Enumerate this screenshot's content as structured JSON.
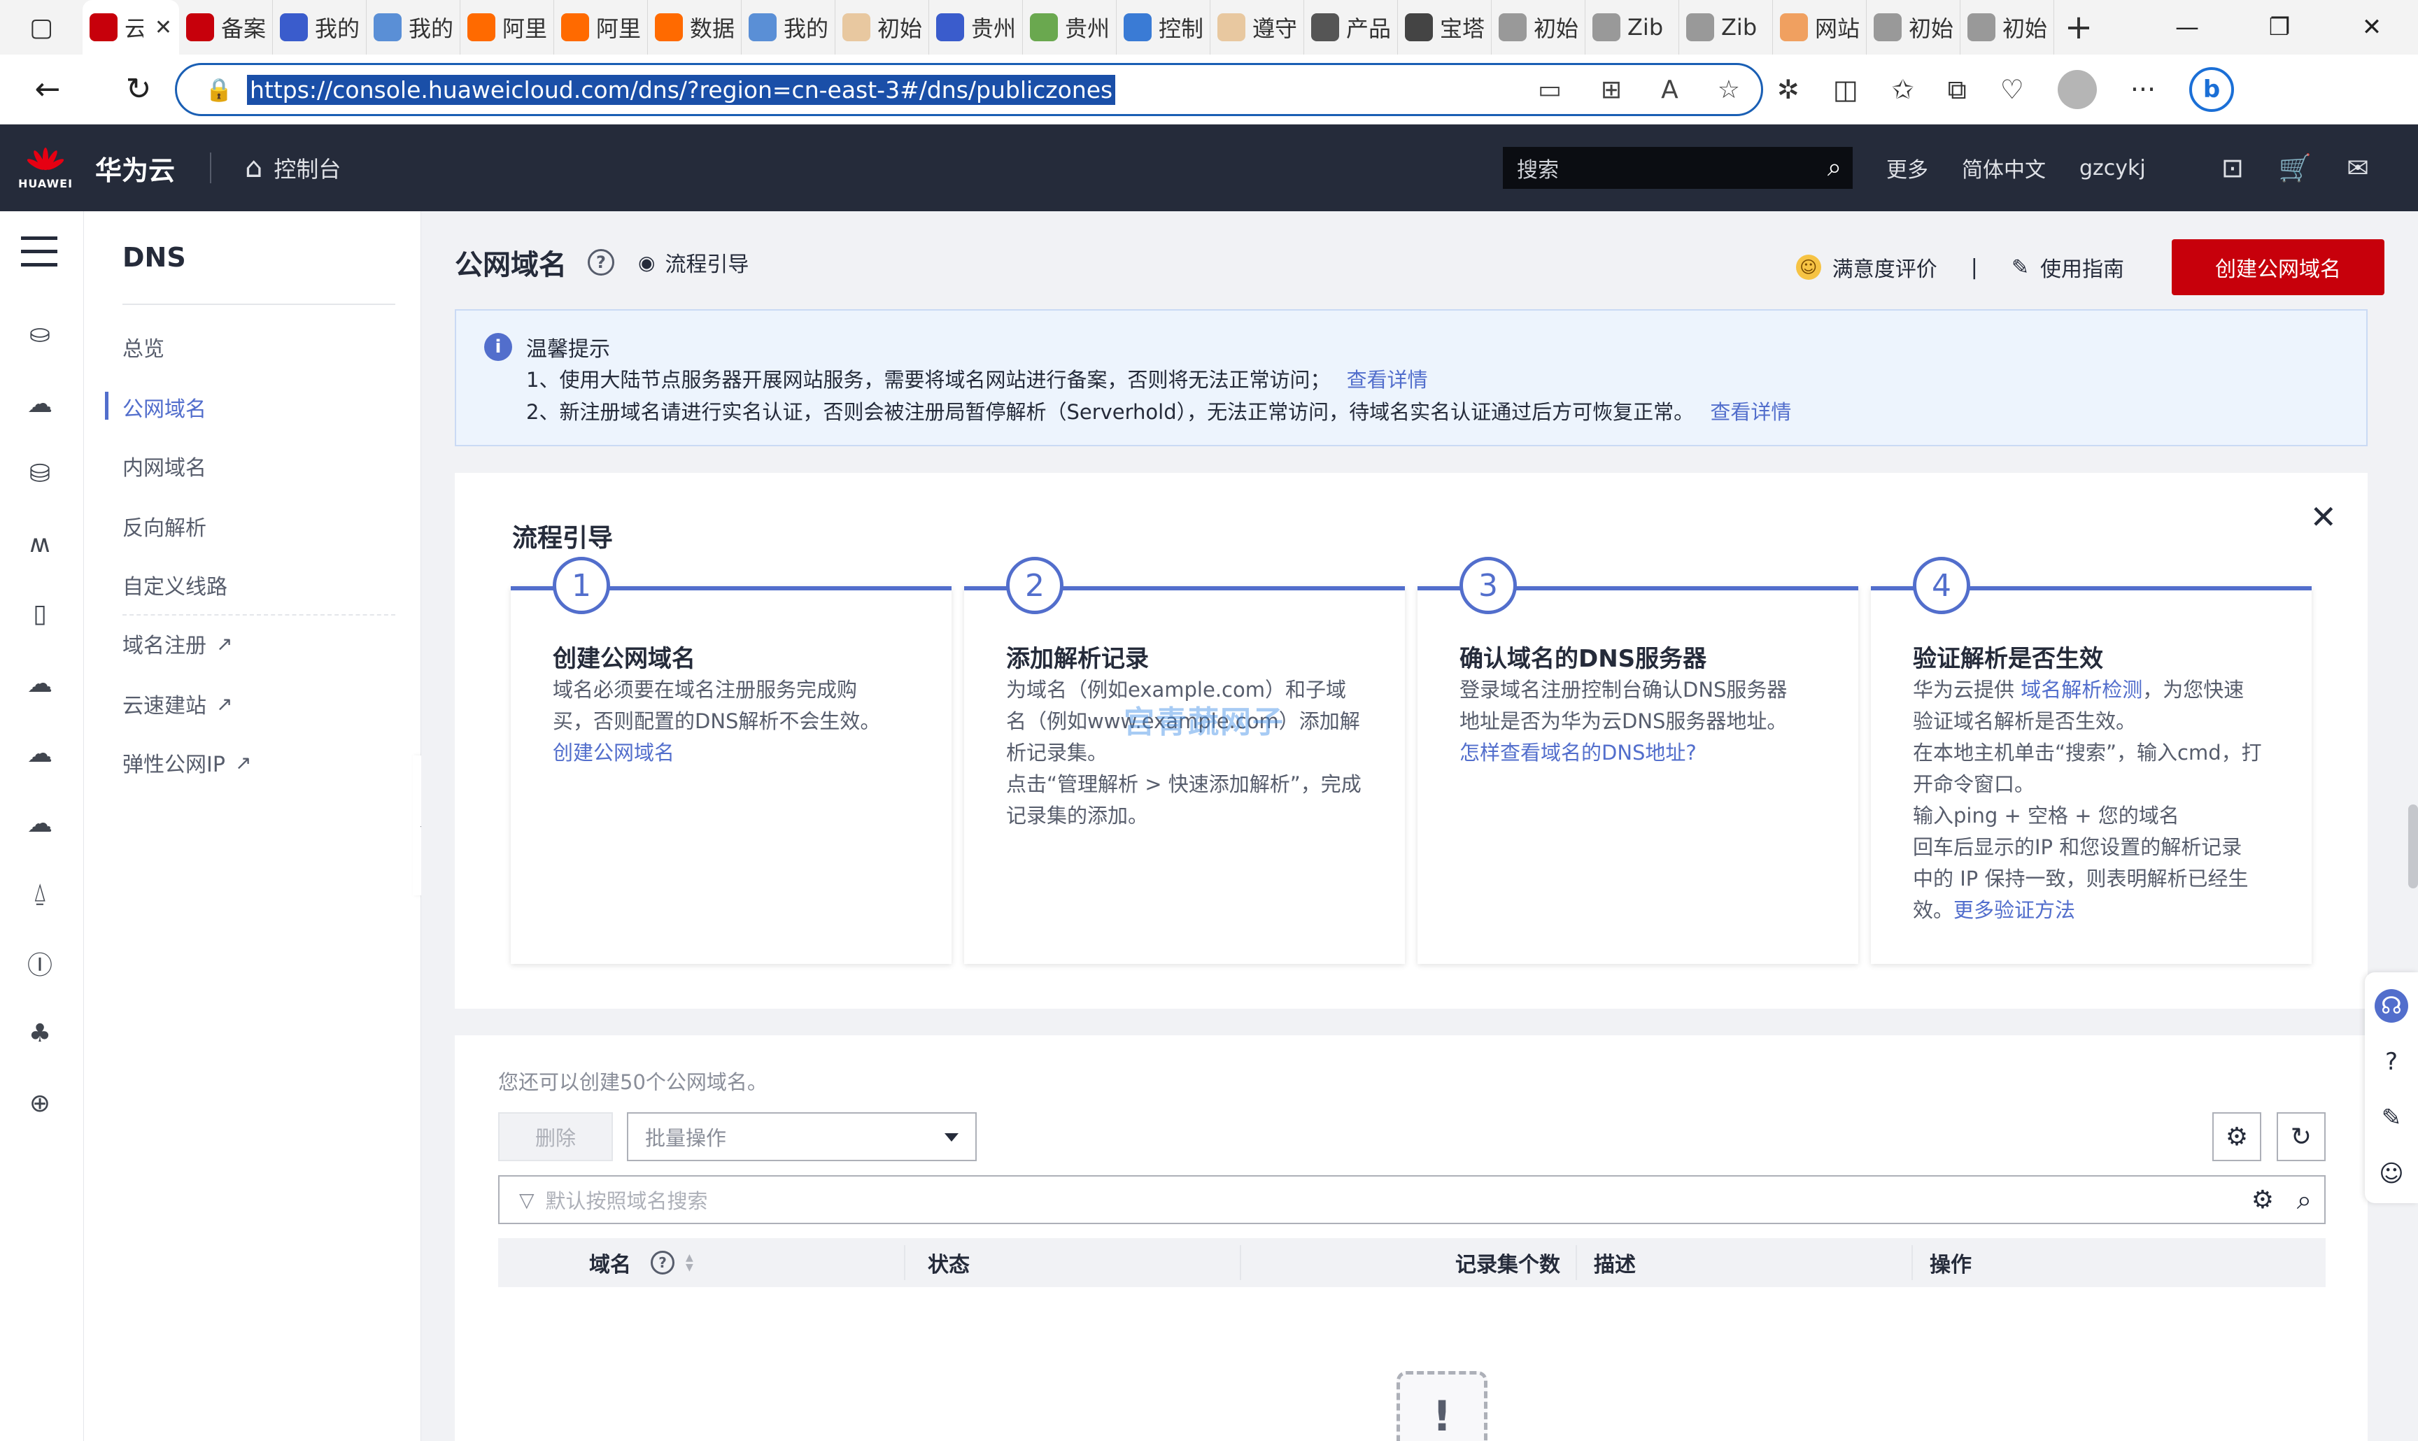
{
  "browser": {
    "tabs": [
      {
        "title": "云帐",
        "active": true,
        "favicon_color": "#c7000b"
      },
      {
        "title": "备案",
        "favicon_color": "#c7000b"
      },
      {
        "title": "我的",
        "favicon_color": "#3a5ccc"
      },
      {
        "title": "我的",
        "favicon_color": "#5a8fd6"
      },
      {
        "title": "阿里",
        "favicon_color": "#ff6a00"
      },
      {
        "title": "阿里",
        "favicon_color": "#ff6a00"
      },
      {
        "title": "数据",
        "favicon_color": "#ff6a00"
      },
      {
        "title": "我的",
        "favicon_color": "#5a8fd6"
      },
      {
        "title": "初始",
        "favicon_color": "#e8c8a0"
      },
      {
        "title": "贵州",
        "favicon_color": "#3a5ccc"
      },
      {
        "title": "贵州",
        "favicon_color": "#6aa84f"
      },
      {
        "title": "控制",
        "favicon_color": "#3a7bd5"
      },
      {
        "title": "遵守",
        "favicon_color": "#e8c8a0"
      },
      {
        "title": "产品",
        "favicon_color": "#555555"
      },
      {
        "title": "宝塔",
        "favicon_color": "#444444"
      },
      {
        "title": "初始",
        "favicon_color": "#999999"
      },
      {
        "title": "Zib",
        "favicon_color": "#999999"
      },
      {
        "title": "Zib",
        "favicon_color": "#999999"
      },
      {
        "title": "网站",
        "favicon_color": "#f0a060"
      },
      {
        "title": "初始",
        "favicon_color": "#999999"
      },
      {
        "title": "初始",
        "favicon_color": "#999999"
      }
    ],
    "url": "https://console.huaweicloud.com/dns/?region=cn-east-3#/dns/publiczones"
  },
  "header": {
    "logo_text": "HUAWEI",
    "brand": "华为云",
    "console_label": "控制台",
    "search_placeholder": "搜索",
    "more": "更多",
    "language": "简体中文",
    "username": "gzcykj"
  },
  "subnav": {
    "title": "DNS",
    "items": [
      {
        "label": "总览"
      },
      {
        "label": "公网域名",
        "active": true
      },
      {
        "label": "内网域名"
      },
      {
        "label": "反向解析"
      },
      {
        "label": "自定义线路"
      },
      {
        "label": "域名注册",
        "external": true
      },
      {
        "label": "云速建站",
        "external": true
      },
      {
        "label": "弹性公网IP",
        "external": true
      }
    ]
  },
  "page": {
    "title": "公网域名",
    "flow_guide_link": "流程引导",
    "satisfaction": "满意度评价",
    "separator": "|",
    "user_guide": "使用指南",
    "create_button": "创建公网域名"
  },
  "notice": {
    "title": "温馨提示",
    "line1": "1、使用大陆节点服务器开展网站服务，需要将域名网站进行备案，否则将无法正常访问；",
    "line1_link": "查看详情",
    "line2": "2、新注册域名请进行实名认证，否则会被注册局暂停解析（Serverhold），无法正常访问，待域名实名认证通过后方可恢复正常。",
    "line2_link": "查看详情"
  },
  "guide": {
    "title": "流程引导",
    "steps": [
      {
        "num": "1",
        "title": "创建公网域名",
        "body1": "域名必须要在域名注册服务完成购",
        "body2": "买，否则配置的DNS解析不会生效。",
        "link": "创建公网域名"
      },
      {
        "num": "2",
        "title": "添加解析记录",
        "body1": "为域名（例如example.com）和子域",
        "body2": "名（例如www.example.com）添加解",
        "body3": "析记录集。",
        "body4": "点击“管理解析 > 快速添加解析”，完成",
        "body5": "记录集的添加。"
      },
      {
        "num": "3",
        "title": "确认域名的DNS服务器",
        "body1": "登录域名注册控制台确认DNS服务器",
        "body2": "地址是否为华为云DNS服务器地址。",
        "link": "怎样查看域名的DNS地址?"
      },
      {
        "num": "4",
        "title": "验证解析是否生效",
        "body1_pre": "华为云提供 ",
        "body1_link": "域名解析检测",
        "body1_post": "，为您快速",
        "body2": "验证域名解析是否生效。",
        "body3": "在本地主机单击“搜索”，输入cmd，打",
        "body4": "开命令窗口。",
        "body5": "输入ping + 空格 + 您的域名",
        "body6": "回车后显示的IP 和您设置的解析记录",
        "body7": "中的 IP 保持一致，则表明解析已经生",
        "body8_pre": "效。",
        "body8_link": "更多验证方法"
      }
    ]
  },
  "list": {
    "quota_text": "您还可以创建50个公网域名。",
    "delete_button": "删除",
    "batch_placeholder": "批量操作",
    "search_placeholder": "默认按照域名搜索",
    "columns": [
      "域名",
      "状态",
      "记录集个数",
      "描述",
      "操作"
    ]
  },
  "watermark": "宫青蔬网子",
  "colors": {
    "header_bg": "#252b3a",
    "primary_red": "#c7000b",
    "link_blue": "#526ecc",
    "notice_bg": "#edf4fd"
  }
}
